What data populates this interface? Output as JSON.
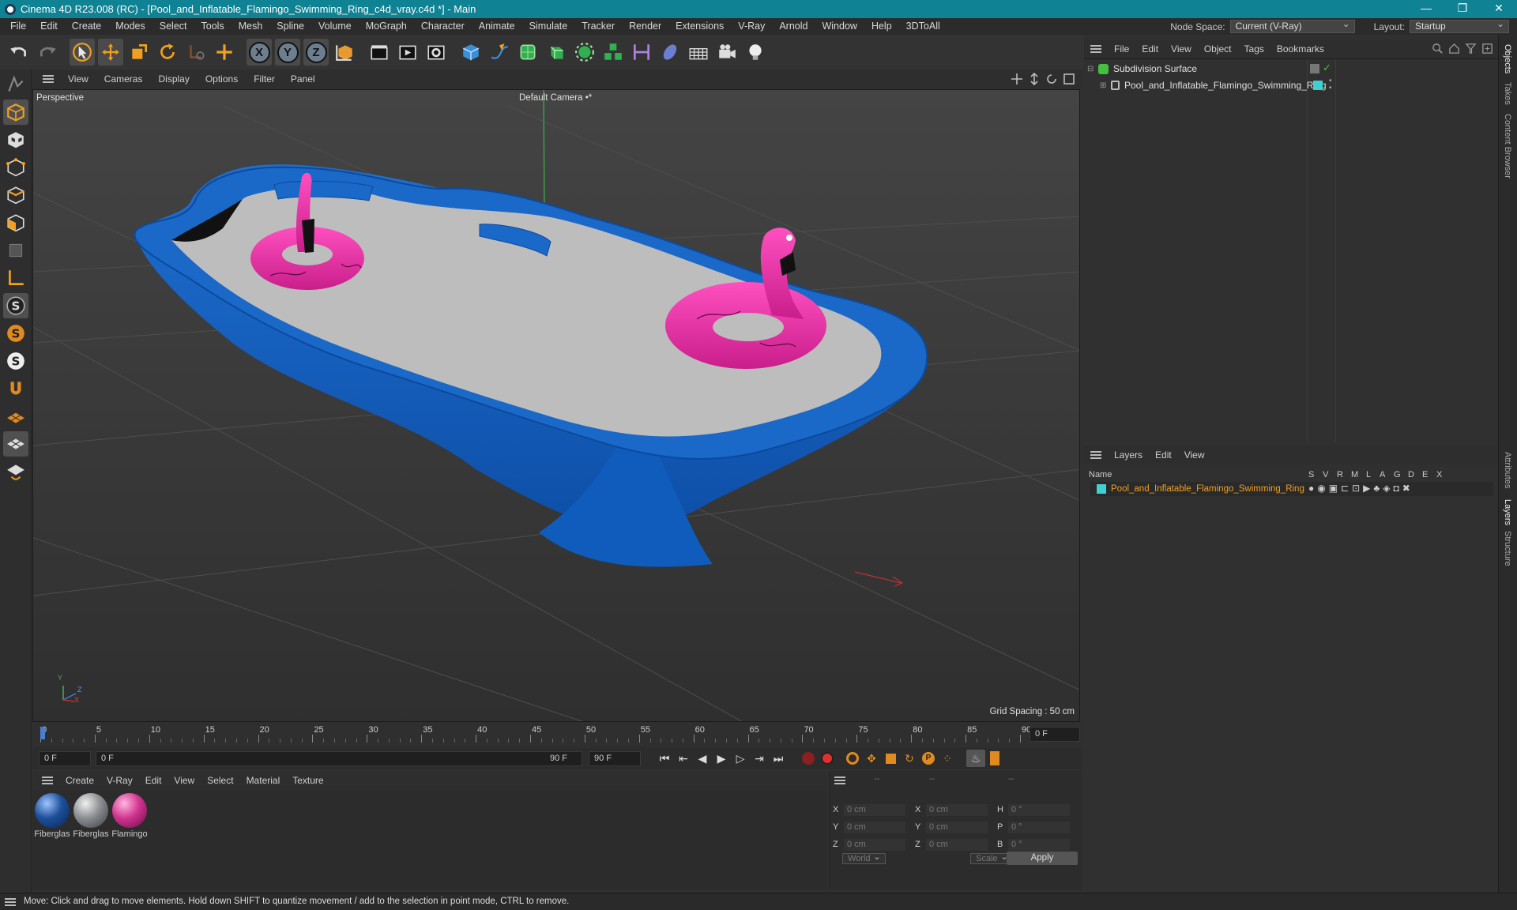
{
  "window": {
    "title": "Cinema 4D R23.008 (RC) - [Pool_and_Inflatable_Flamingo_Swimming_Ring_c4d_vray.c4d *] - Main",
    "min": "—",
    "max": "❐",
    "close": "✕"
  },
  "menubar": {
    "items": [
      "File",
      "Edit",
      "Create",
      "Modes",
      "Select",
      "Tools",
      "Mesh",
      "Spline",
      "Volume",
      "MoGraph",
      "Character",
      "Animate",
      "Simulate",
      "Tracker",
      "Render",
      "Extensions",
      "V-Ray",
      "Arnold",
      "Window",
      "Help",
      "3DToAll"
    ],
    "node_space_label": "Node Space:",
    "node_space_value": "Current (V-Ray)",
    "layout_label": "Layout:",
    "layout_value": "Startup"
  },
  "toolbar": {
    "x_label": "X",
    "y_label": "Y",
    "z_label": "Z"
  },
  "viewport": {
    "menu": [
      "View",
      "Cameras",
      "Display",
      "Options",
      "Filter",
      "Panel"
    ],
    "view_name": "Perspective",
    "camera": "Default Camera",
    "camera_icon": "•*",
    "grid_spacing": "Grid Spacing : 50 cm",
    "axis_y": "Y",
    "axis_z": "Z",
    "axis_x": "X"
  },
  "timeline": {
    "ticks": [
      "0",
      "5",
      "10",
      "15",
      "20",
      "25",
      "30",
      "35",
      "40",
      "45",
      "50",
      "55",
      "60",
      "65",
      "70",
      "75",
      "80",
      "85",
      "90"
    ],
    "current_frame": "0 F",
    "start_field": "0 F",
    "range_start": "0 F",
    "range_end": "90 F",
    "end_field": "90 F"
  },
  "materials": {
    "menu": [
      "Create",
      "V-Ray",
      "Edit",
      "View",
      "Select",
      "Material",
      "Texture"
    ],
    "items": [
      {
        "name": "Fiberglas",
        "color": "#1d4f9a"
      },
      {
        "name": "Fiberglas",
        "color": "#8a8d91"
      },
      {
        "name": "Flamingo",
        "color": "#d0348f"
      }
    ]
  },
  "coords": {
    "header": [
      "--",
      "--",
      "--"
    ],
    "rows": [
      {
        "k1": "X",
        "v1": "0 cm",
        "k2": "X",
        "v2": "0 cm",
        "k3": "H",
        "v3": "0 °"
      },
      {
        "k1": "Y",
        "v1": "0 cm",
        "k2": "Y",
        "v2": "0 cm",
        "k3": "P",
        "v3": "0 °"
      },
      {
        "k1": "Z",
        "v1": "0 cm",
        "k2": "Z",
        "v2": "0 cm",
        "k3": "B",
        "v3": "0 °"
      }
    ],
    "space": "World",
    "mode": "Scale",
    "apply": "Apply"
  },
  "status": "Move: Click and drag to move elements. Hold down SHIFT to quantize movement / add to the selection in point mode, CTRL to remove.",
  "objects": {
    "menu": [
      "File",
      "Edit",
      "View",
      "Object",
      "Tags",
      "Bookmarks"
    ],
    "items": [
      {
        "name": "Subdivision Surface",
        "color": "#44c040"
      },
      {
        "name": "Pool_and_Inflatable_Flamingo_Swimming_Ring",
        "color": "#3fd0d0"
      }
    ]
  },
  "layers": {
    "menu": [
      "Layers",
      "Edit",
      "View"
    ],
    "columns": [
      "Name",
      "S",
      "V",
      "R",
      "M",
      "L",
      "A",
      "G",
      "D",
      "E",
      "X"
    ],
    "items": [
      {
        "name": "Pool_and_Inflatable_Flamingo_Swimming_Ring",
        "color": "#3fd0d0"
      }
    ]
  },
  "side_tabs": [
    "Objects",
    "Takes",
    "Content Browser",
    "Attributes",
    "Layers",
    "Structure"
  ],
  "colors": {
    "accent": "#0f8293",
    "pool": "#1565c0",
    "flamingo": "#e83aa8"
  }
}
